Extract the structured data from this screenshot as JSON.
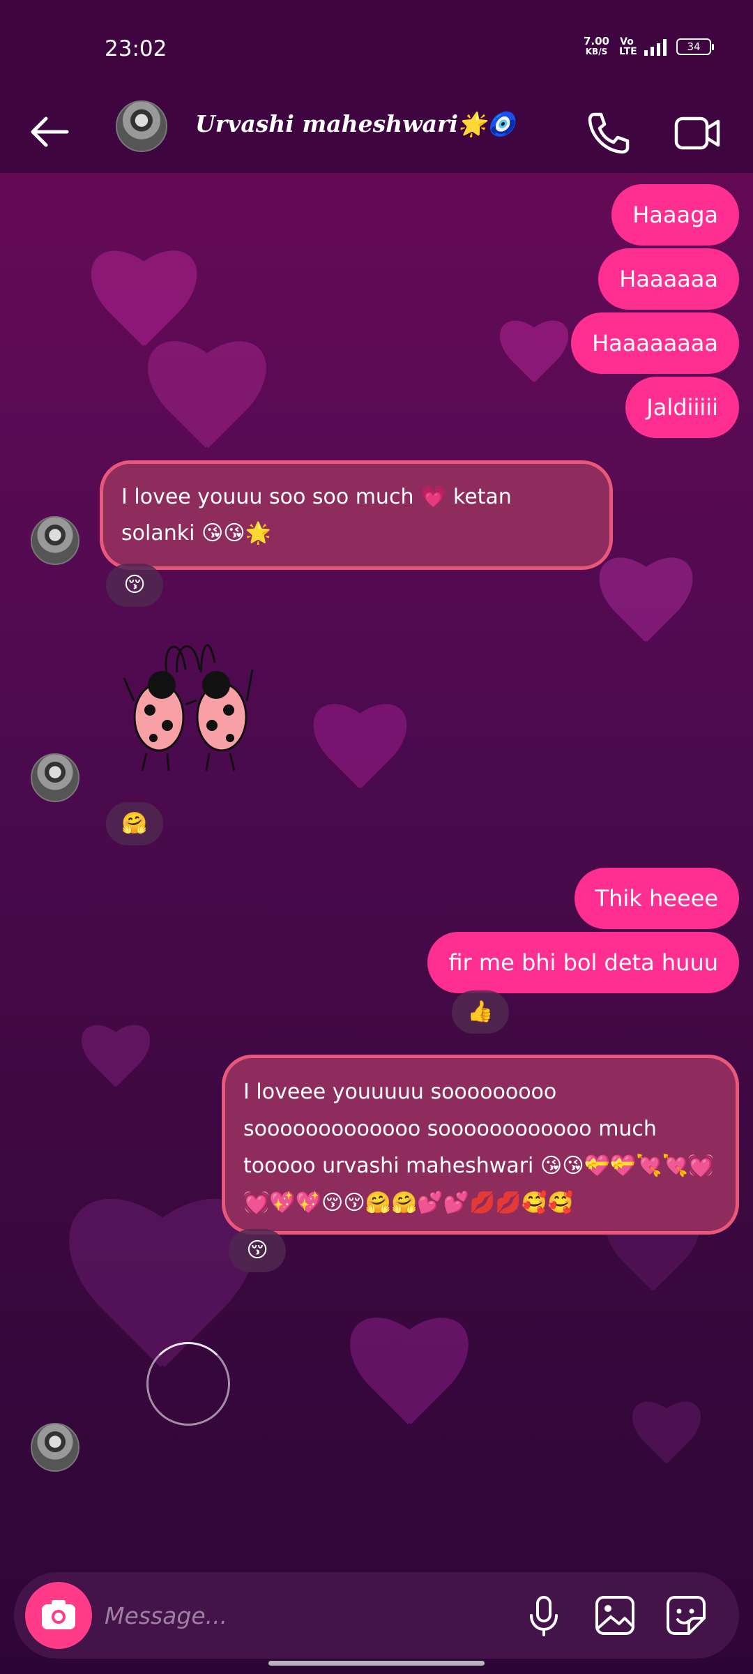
{
  "status_bar": {
    "time": "23:02",
    "net_speed_value": "7.00",
    "net_speed_unit": "KB/S",
    "volte": "Vo LTE",
    "network": "4G",
    "battery": "34"
  },
  "header": {
    "contact_name": "Urvashi maheshwari🌟🧿",
    "back_icon": "arrow-left-icon",
    "call_icon": "phone-icon",
    "video_icon": "video-camera-icon"
  },
  "messages": [
    {
      "text": "Haaaga"
    },
    {
      "text": "Haaaaaa"
    },
    {
      "text": "Haaaaaaaa"
    },
    {
      "text": "Jaldiiiii"
    },
    {
      "text": "I lovee youuu soo soo much 💗 ketan solanki 😘😘🌟",
      "reaction": "😚"
    },
    {
      "reaction": "🤗"
    },
    {
      "text": "Thik heeee"
    },
    {
      "text": "fir me bhi bol deta huuu",
      "reaction": "👍"
    },
    {
      "text": "I loveee youuuuu sooooooooo sooooooooooooo soooooooooooo much tooooo urvashi maheshwari 😘😘💝💝💘💘💓💓💖💖😚😚🤗🤗💕💕💋💋🥰🥰",
      "reaction": "😚"
    }
  ],
  "composer": {
    "placeholder": "Message...",
    "camera_icon": "camera-icon",
    "mic_icon": "microphone-icon",
    "gallery_icon": "image-icon",
    "sticker_icon": "sticker-icon"
  },
  "colors": {
    "outgoing_bubble": "#ff2f92",
    "highlight_bubble": "#8f2c5e",
    "highlight_border": "#e9587a",
    "header_bg": "#3e0541"
  }
}
